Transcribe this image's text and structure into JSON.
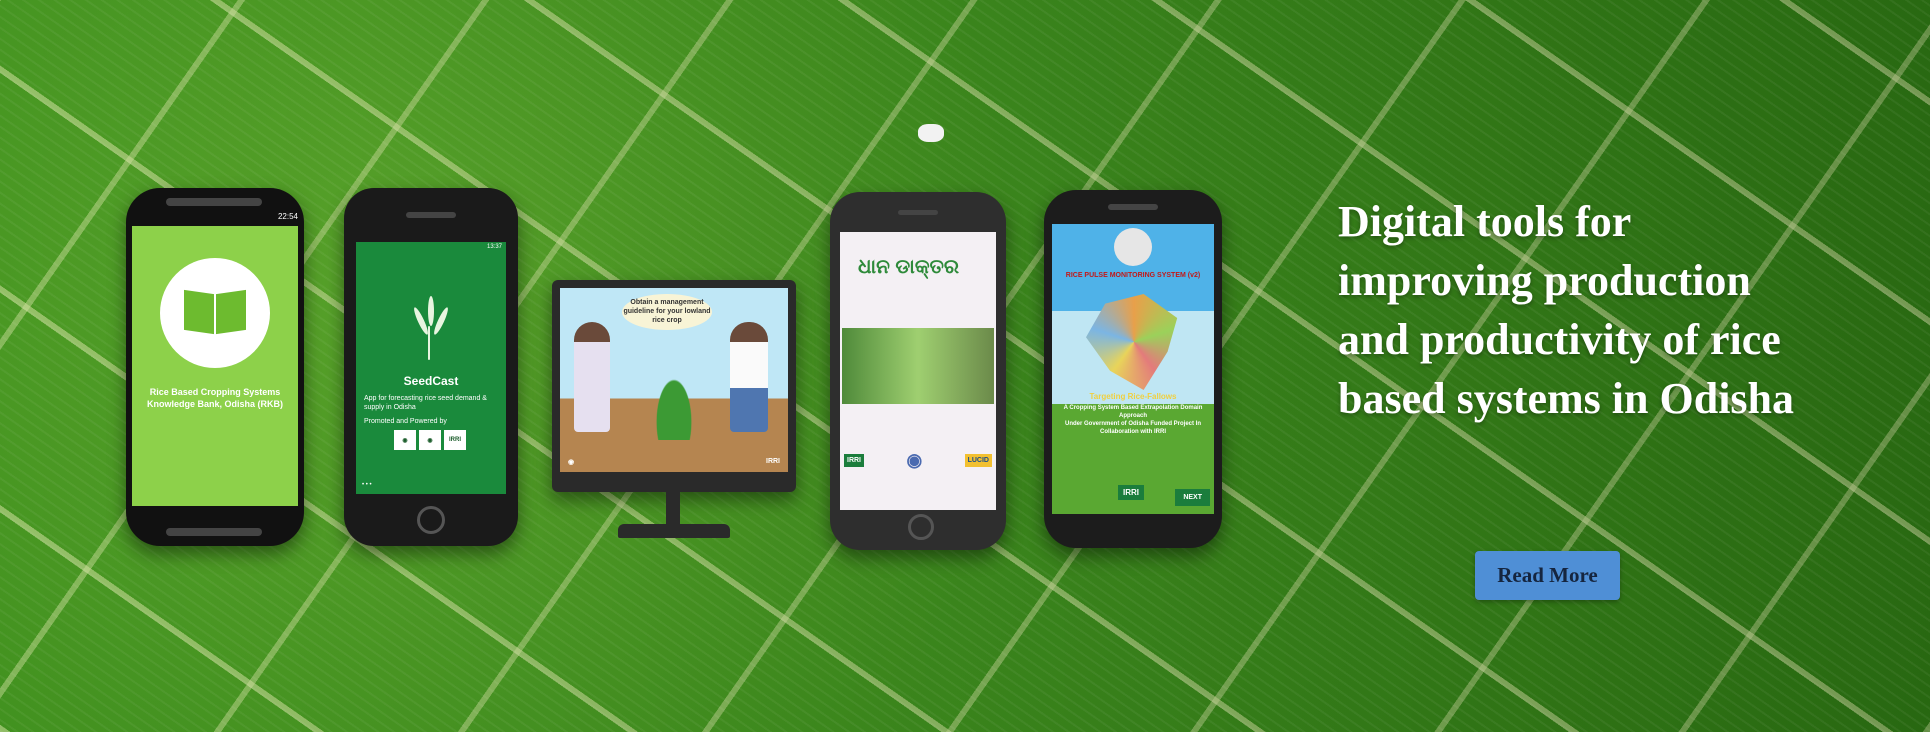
{
  "hero": {
    "headline": "Digital tools for improving production and productivity of rice based systems in Odisha",
    "read_more_label": "Read More"
  },
  "apps": {
    "rkb": {
      "status_time": "22:54",
      "title": "Rice Based Cropping Systems Knowledge Bank, Odisha (RKB)"
    },
    "seedcast": {
      "status_time": "13:37",
      "name": "SeedCast",
      "description": "App for forecasting rice seed demand & supply in Odisha",
      "promoted": "Promoted and Powered by",
      "logo_irri": "IRRI"
    },
    "management": {
      "bubble": "Obtain a management guideline for your lowland rice crop",
      "logo_irri": "IRRI"
    },
    "dhan": {
      "brand": "ଧାନ ଡାକ୍ତର",
      "logo_irri": "IRRI",
      "lucid": "LUCID"
    },
    "ricepulse": {
      "system_name": "RICE PULSE MONITORING SYSTEM (v2)",
      "tagline": "Targeting Rice-Fallows",
      "subtitle": "A Cropping System Based Extrapolation Domain Approach",
      "funding": "Under Government of Odisha Funded Project In Collaboration with IRRI",
      "logo_irri": "IRRI",
      "next_label": "NEXT"
    }
  },
  "colors": {
    "button_bg": "#4f8fd6",
    "headline_text": "#ffffff",
    "rkb_screen": "#8dd14a",
    "seedcast_screen": "#1a8a3c"
  }
}
